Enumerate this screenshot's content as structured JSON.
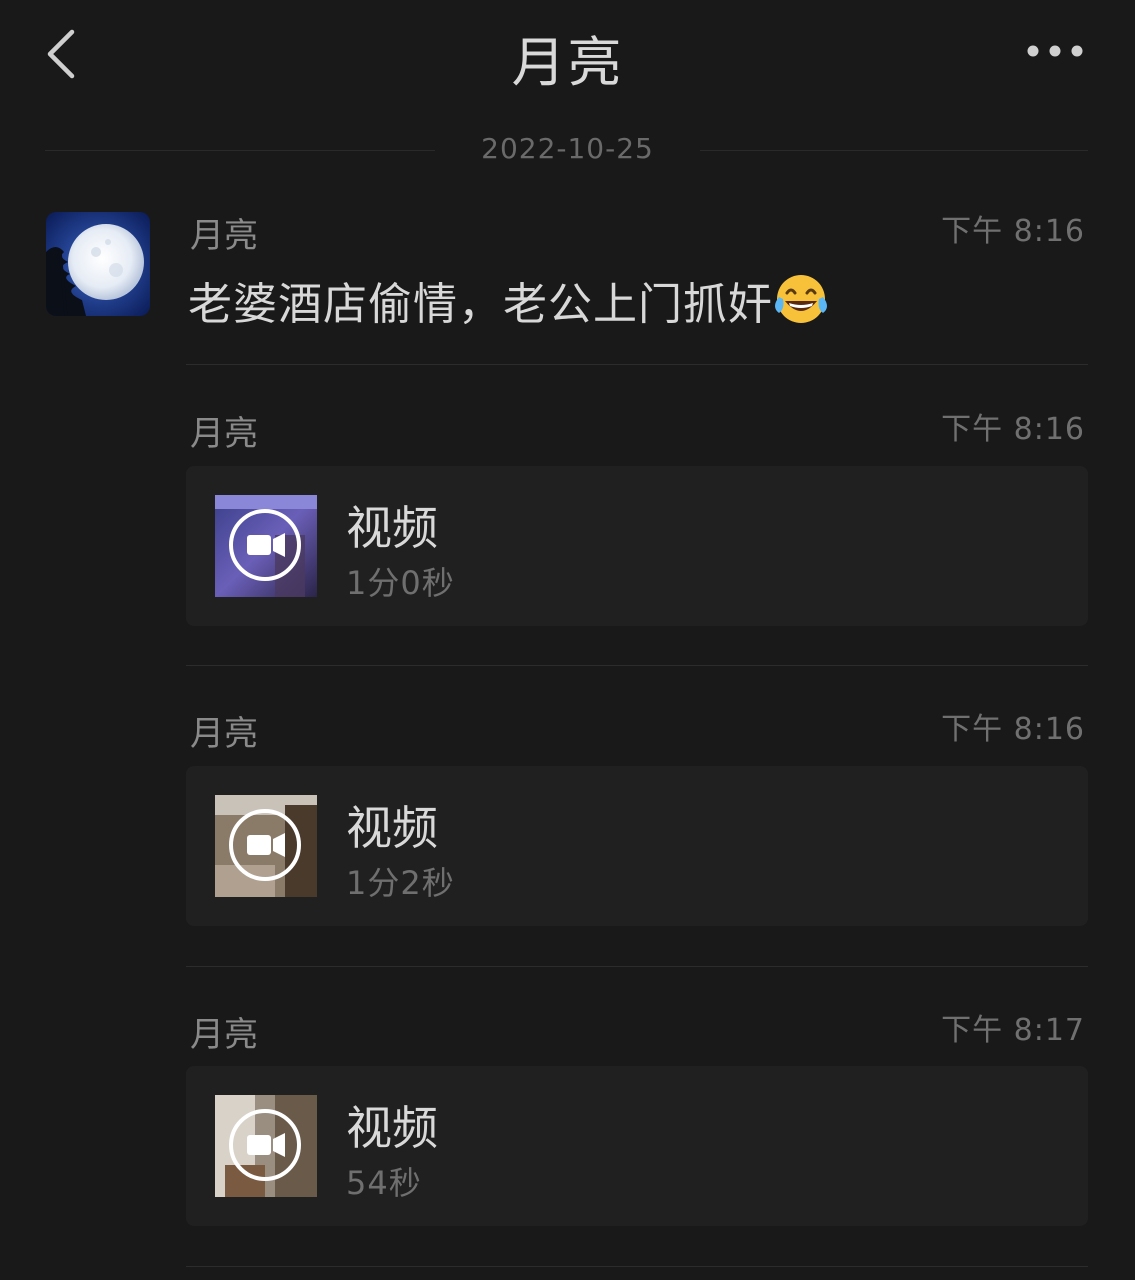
{
  "header": {
    "back_icon": "chevron-left-icon",
    "title": "月亮",
    "more_icon": "more-dots-icon"
  },
  "date_divider": "2022-10-25",
  "messages": [
    {
      "sender": "月亮",
      "time": "下午 8:16",
      "text": "老婆酒店偷情，老公上门抓奸",
      "emoji": "face-with-tears-of-joy"
    },
    {
      "sender": "月亮",
      "time": "下午 8:16",
      "video": {
        "title": "视频",
        "duration": "1分0秒"
      }
    },
    {
      "sender": "月亮",
      "time": "下午 8:16",
      "video": {
        "title": "视频",
        "duration": "1分2秒"
      }
    },
    {
      "sender": "月亮",
      "time": "下午 8:17",
      "video": {
        "title": "视频",
        "duration": "54秒"
      }
    }
  ],
  "colors": {
    "background": "#191919",
    "card": "#202020",
    "primary_text": "#d9d9d9",
    "secondary_text": "#8a8a8a"
  }
}
